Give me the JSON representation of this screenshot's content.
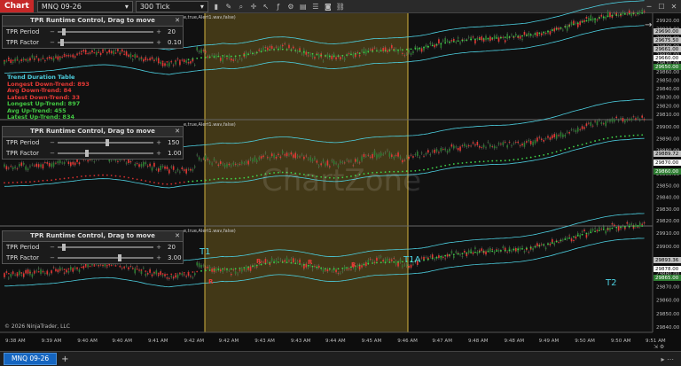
{
  "toolbar": {
    "chart_tab": "Chart",
    "instrument": "MNQ 09-26",
    "interval": "300 Tick"
  },
  "panels": [
    {
      "title": "TPR Runtime Control, Drag to move",
      "period_label": "TPR Period",
      "period_value": "20",
      "period_level": 0.05,
      "factor_label": "TPR Factor",
      "factor_value": "0.10",
      "factor_level": 0.03
    },
    {
      "title": "TPR Runtime Control, Drag to move",
      "period_label": "TPR Period",
      "period_value": "150",
      "period_level": 0.52,
      "factor_label": "TPR Factor",
      "factor_value": "1.00",
      "factor_level": 0.3
    },
    {
      "title": "TPR Runtime Control, Drag to move",
      "period_label": "TPR Period",
      "period_value": "20",
      "period_level": 0.05,
      "factor_label": "TPR Factor",
      "factor_value": "3.00",
      "factor_level": 0.65
    }
  ],
  "indicator_labels": [
    "e,true,Alert1.wav,false)",
    "e,true,Alert1.wav,false)",
    "e,true,Alert1.wav,false)"
  ],
  "trend_table": {
    "title": "Trend Duration Table",
    "longest_down": "Longest Down-Trend: 893",
    "avg_down": "Avg Down-Trend: 84",
    "latest_down": "Latest Down-Trend: 33",
    "longest_up": "Longest Up-Trend: 897",
    "avg_up": "Avg Up-Trend: 455",
    "latest_up": "Latest Up-Trend: 834"
  },
  "watermark": "ChartZone",
  "annotations": {
    "t1": "T1",
    "t1a": "T1A",
    "t2": "T2",
    "r": "R"
  },
  "y_axes": [
    {
      "ticks": [
        "29920.00",
        "29910.00",
        "29900.00",
        "29890.00",
        "29880.00",
        "29870.00",
        "29860.00",
        "29850.00",
        "29840.00",
        "29830.00",
        "29820.00",
        "29810.00"
      ],
      "badges": [
        {
          "text": "29690.00",
          "color": "#c0c0c0",
          "fg": "#000"
        },
        {
          "text": "29675.50",
          "color": "#c0c0c0",
          "fg": "#000"
        },
        {
          "text": "29661.00",
          "color": "#c0c0c0",
          "fg": "#000"
        },
        {
          "text": "29660.00",
          "color": "#ffffff",
          "fg": "#000"
        },
        {
          "text": "29650.00",
          "color": "#2e7d32",
          "fg": "#fff"
        }
      ]
    },
    {
      "ticks": [
        "29900.00",
        "29890.00",
        "29880.00",
        "29870.00",
        "29860.00",
        "29850.00",
        "29840.00",
        "29830.00",
        "29820.00"
      ],
      "badges": [
        {
          "text": "29889.72",
          "color": "#c0c0c0",
          "fg": "#000"
        },
        {
          "text": "29870.00",
          "color": "#ffffff",
          "fg": "#000"
        },
        {
          "text": "29860.00",
          "color": "#2e7d32",
          "fg": "#fff"
        }
      ]
    },
    {
      "ticks": [
        "29910.00",
        "29900.00",
        "29890.00",
        "29880.00",
        "29870.00",
        "29860.00",
        "29850.00",
        "29840.00"
      ],
      "badges": [
        {
          "text": "29893.36",
          "color": "#c0c0c0",
          "fg": "#000"
        },
        {
          "text": "29878.00",
          "color": "#ffffff",
          "fg": "#000"
        },
        {
          "text": "29865.00",
          "color": "#2e7d32",
          "fg": "#fff"
        }
      ]
    }
  ],
  "x_axis": [
    "9:38 AM",
    "9:39 AM",
    "9:40 AM",
    "9:40 AM",
    "9:41 AM",
    "9:42 AM",
    "9:42 AM",
    "9:43 AM",
    "9:43 AM",
    "9:44 AM",
    "9:45 AM",
    "9:46 AM",
    "9:47 AM",
    "9:48 AM",
    "9:48 AM",
    "9:49 AM",
    "9:50 AM",
    "9:50 AM",
    "9:51 AM"
  ],
  "copyright": "© 2026 NinjaTrader, LLC",
  "bottom_tab": "MNQ 09-26",
  "add_tab": "+",
  "colors": {
    "up": "#2e7d32",
    "down": "#e53935",
    "band": "#4dd0e1",
    "highlight": "#6b5a1e"
  }
}
